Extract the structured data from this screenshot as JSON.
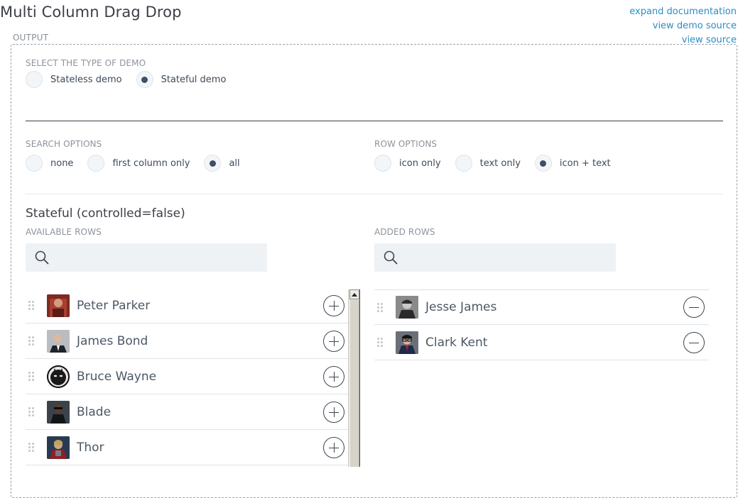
{
  "header": {
    "title": "Multi Column Drag Drop",
    "links": [
      "expand documentation",
      "view demo source",
      "view source"
    ]
  },
  "output_label": "OUTPUT",
  "demo_type": {
    "label": "SELECT THE TYPE OF DEMO",
    "options": [
      {
        "label": "Stateless demo",
        "selected": false
      },
      {
        "label": "Stateful demo",
        "selected": true
      }
    ]
  },
  "search_options": {
    "label": "SEARCH OPTIONS",
    "options": [
      {
        "label": "none",
        "selected": false
      },
      {
        "label": "first column only",
        "selected": false
      },
      {
        "label": "all",
        "selected": true
      }
    ]
  },
  "row_options": {
    "label": "ROW OPTIONS",
    "options": [
      {
        "label": "icon only",
        "selected": false
      },
      {
        "label": "text only",
        "selected": false
      },
      {
        "label": "icon + text",
        "selected": true
      }
    ]
  },
  "stateful_title": "Stateful (controlled=false)",
  "available": {
    "label": "AVAILABLE ROWS",
    "search_value": "",
    "rows": [
      {
        "name": "Peter Parker",
        "icon": "peter-parker-avatar",
        "color": "#8b2f24"
      },
      {
        "name": "James Bond",
        "icon": "james-bond-avatar",
        "color": "#7a7f86"
      },
      {
        "name": "Bruce Wayne",
        "icon": "batman-avatar",
        "color": "#1b1b1b"
      },
      {
        "name": "Blade",
        "icon": "blade-avatar",
        "color": "#2b3138"
      },
      {
        "name": "Thor",
        "icon": "thor-avatar",
        "color": "#5a2430"
      }
    ]
  },
  "added": {
    "label": "ADDED ROWS",
    "search_value": "",
    "rows": [
      {
        "name": "Jesse James",
        "icon": "jesse-james-avatar",
        "color": "#6f6f6f"
      },
      {
        "name": "Clark Kent",
        "icon": "clark-kent-avatar",
        "color": "#3c3a3a"
      }
    ]
  }
}
